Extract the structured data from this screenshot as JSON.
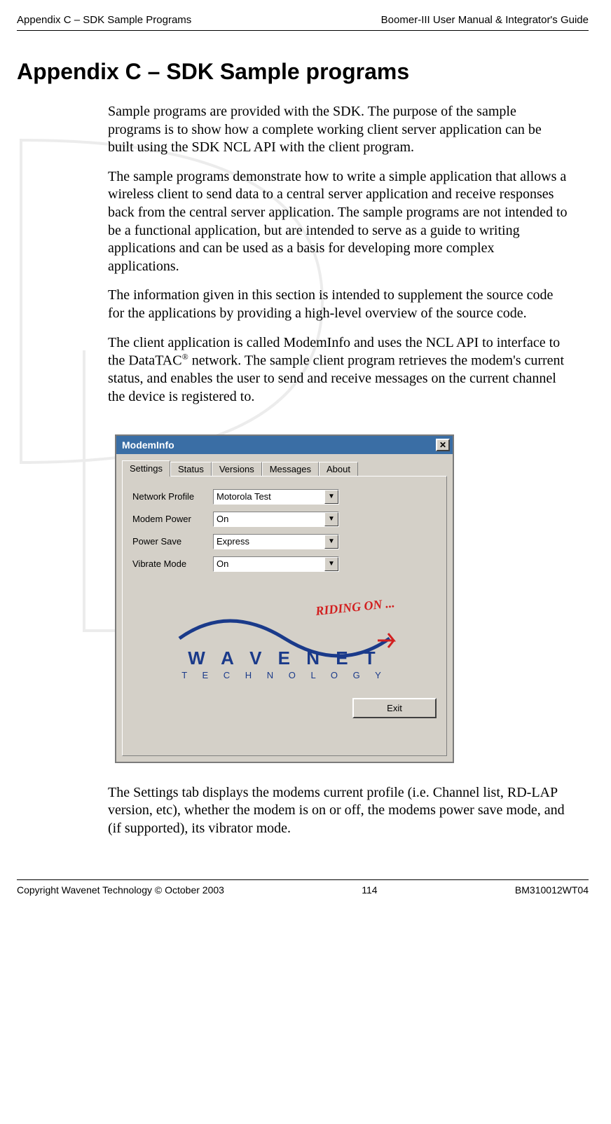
{
  "header": {
    "left": "Appendix C – SDK Sample Programs",
    "right": "Boomer-III User Manual & Integrator's Guide"
  },
  "title": "Appendix C – SDK Sample programs",
  "paragraphs": {
    "p1": "Sample programs are provided with the SDK. The purpose of the sample programs is to show how a complete working client server application can be built using the SDK NCL API with the client program.",
    "p2": "The sample programs demonstrate how to write a simple application that allows a wireless client to send data to a central server application and receive responses back from the central server application. The sample programs are not intended to be a functional application, but are intended to serve as a guide to writing applications and can be used as a basis for developing more complex applications.",
    "p3": "The information given in this section is intended to supplement the source code for the applications by providing a high-level overview of the source code.",
    "p4_pre": "The client application is called ModemInfo and uses the NCL API to interface to the DataTAC",
    "p4_sup": "®",
    "p4_post": " network. The sample client program retrieves the modem's current status, and enables the user to send and receive messages on the current channel the device is registered to.",
    "p5": "The Settings tab displays the modems current profile (i.e. Channel list, RD-LAP version, etc), whether the modem is on or off, the modems power save mode, and (if supported), its vibrator mode."
  },
  "dialog": {
    "title": "ModemInfo",
    "close_glyph": "✕",
    "tabs": [
      "Settings",
      "Status",
      "Versions",
      "Messages",
      "About"
    ],
    "active_tab": 0,
    "fields": [
      {
        "label": "Network Profile",
        "value": "Motorola Test"
      },
      {
        "label": "Modem Power",
        "value": "On"
      },
      {
        "label": "Power Save",
        "value": "Express"
      },
      {
        "label": "Vibrate Mode",
        "value": "On"
      }
    ],
    "logo": {
      "tagline": "RIDING ON ...",
      "brand": "W  A  V  E  N  E  T",
      "sub": "T  E  C  H  N  O  L  O  G  Y"
    },
    "exit_label": "Exit"
  },
  "footer": {
    "left": "Copyright Wavenet Technology © October 2003",
    "center": "114",
    "right": "BM310012WT04"
  }
}
